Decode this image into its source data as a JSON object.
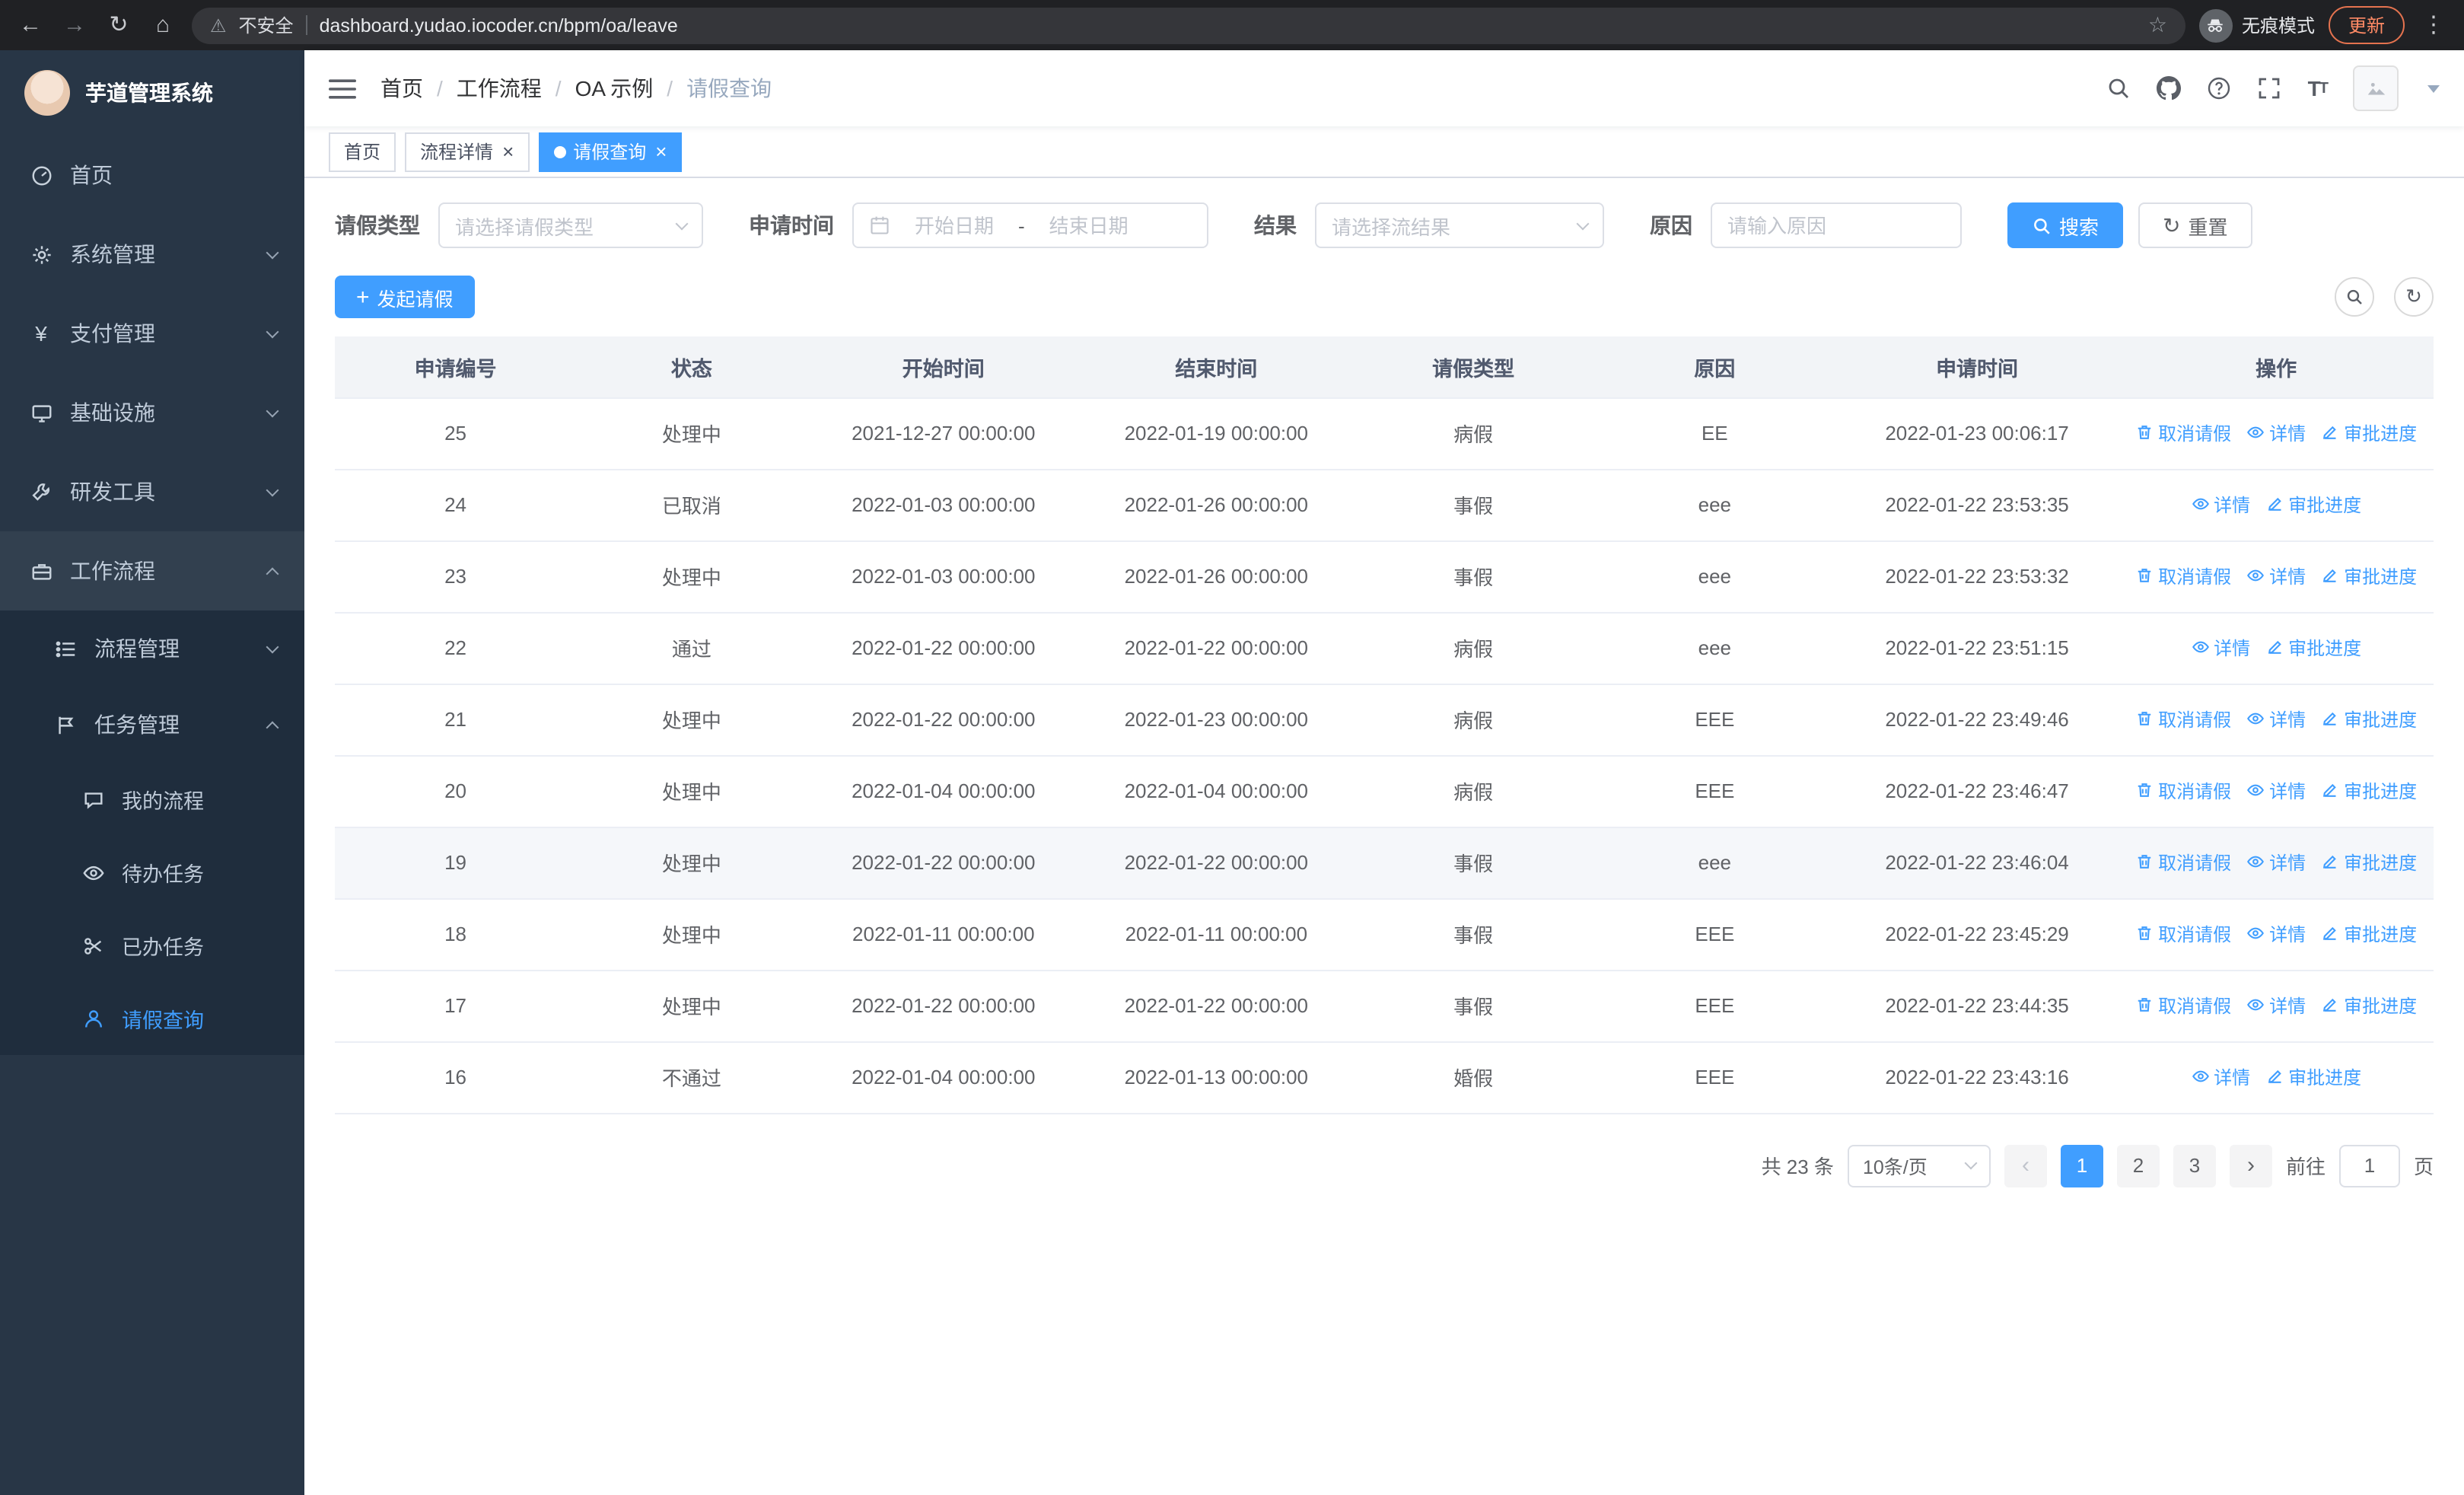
{
  "browser": {
    "security_warning": "不安全",
    "url": "dashboard.yudao.iocoder.cn/bpm/oa/leave",
    "incognito_label": "无痕模式",
    "update_label": "更新"
  },
  "sidebar": {
    "logo_title": "芋道管理系统",
    "menu": [
      {
        "label": "首页"
      },
      {
        "label": "系统管理"
      },
      {
        "label": "支付管理"
      },
      {
        "label": "基础设施"
      },
      {
        "label": "研发工具"
      },
      {
        "label": "工作流程"
      }
    ],
    "submenu": [
      {
        "label": "流程管理"
      },
      {
        "label": "任务管理"
      }
    ],
    "task_menu": [
      {
        "label": "我的流程"
      },
      {
        "label": "待办任务"
      },
      {
        "label": "已办任务"
      },
      {
        "label": "请假查询"
      }
    ]
  },
  "header": {
    "breadcrumb": [
      "首页",
      "工作流程",
      "OA 示例",
      "请假查询"
    ],
    "breadcrumb_separator": "/"
  },
  "tabs": [
    {
      "label": "首页",
      "closable": false,
      "active": false
    },
    {
      "label": "流程详情",
      "closable": true,
      "active": false
    },
    {
      "label": "请假查询",
      "closable": true,
      "active": true
    }
  ],
  "filters": {
    "leave_type_label": "请假类型",
    "leave_type_placeholder": "请选择请假类型",
    "apply_time_label": "申请时间",
    "start_date_placeholder": "开始日期",
    "range_separator": "-",
    "end_date_placeholder": "结束日期",
    "result_label": "结果",
    "result_placeholder": "请选择流结果",
    "reason_label": "原因",
    "reason_placeholder": "请输入原因",
    "search_label": "搜索",
    "reset_label": "重置"
  },
  "toolbar": {
    "create_label": "发起请假"
  },
  "table": {
    "columns": [
      "申请编号",
      "状态",
      "开始时间",
      "结束时间",
      "请假类型",
      "原因",
      "申请时间",
      "操作"
    ],
    "action_labels": {
      "cancel": "取消请假",
      "detail": "详情",
      "progress": "审批进度"
    },
    "rows": [
      {
        "id": "25",
        "status": "处理中",
        "start": "2021-12-27 00:00:00",
        "end": "2022-01-19 00:00:00",
        "type": "病假",
        "reason": "EE",
        "applied": "2022-01-23 00:06:17",
        "actions": [
          "cancel",
          "detail",
          "progress"
        ]
      },
      {
        "id": "24",
        "status": "已取消",
        "start": "2022-01-03 00:00:00",
        "end": "2022-01-26 00:00:00",
        "type": "事假",
        "reason": "eee",
        "applied": "2022-01-22 23:53:35",
        "actions": [
          "detail",
          "progress"
        ]
      },
      {
        "id": "23",
        "status": "处理中",
        "start": "2022-01-03 00:00:00",
        "end": "2022-01-26 00:00:00",
        "type": "事假",
        "reason": "eee",
        "applied": "2022-01-22 23:53:32",
        "actions": [
          "cancel",
          "detail",
          "progress"
        ]
      },
      {
        "id": "22",
        "status": "通过",
        "start": "2022-01-22 00:00:00",
        "end": "2022-01-22 00:00:00",
        "type": "病假",
        "reason": "eee",
        "applied": "2022-01-22 23:51:15",
        "actions": [
          "detail",
          "progress"
        ]
      },
      {
        "id": "21",
        "status": "处理中",
        "start": "2022-01-22 00:00:00",
        "end": "2022-01-23 00:00:00",
        "type": "病假",
        "reason": "EEE",
        "applied": "2022-01-22 23:49:46",
        "actions": [
          "cancel",
          "detail",
          "progress"
        ]
      },
      {
        "id": "20",
        "status": "处理中",
        "start": "2022-01-04 00:00:00",
        "end": "2022-01-04 00:00:00",
        "type": "病假",
        "reason": "EEE",
        "applied": "2022-01-22 23:46:47",
        "actions": [
          "cancel",
          "detail",
          "progress"
        ]
      },
      {
        "id": "19",
        "status": "处理中",
        "start": "2022-01-22 00:00:00",
        "end": "2022-01-22 00:00:00",
        "type": "事假",
        "reason": "eee",
        "applied": "2022-01-22 23:46:04",
        "actions": [
          "cancel",
          "detail",
          "progress"
        ],
        "hover": true
      },
      {
        "id": "18",
        "status": "处理中",
        "start": "2022-01-11 00:00:00",
        "end": "2022-01-11 00:00:00",
        "type": "事假",
        "reason": "EEE",
        "applied": "2022-01-22 23:45:29",
        "actions": [
          "cancel",
          "detail",
          "progress"
        ]
      },
      {
        "id": "17",
        "status": "处理中",
        "start": "2022-01-22 00:00:00",
        "end": "2022-01-22 00:00:00",
        "type": "事假",
        "reason": "EEE",
        "applied": "2022-01-22 23:44:35",
        "actions": [
          "cancel",
          "detail",
          "progress"
        ]
      },
      {
        "id": "16",
        "status": "不通过",
        "start": "2022-01-04 00:00:00",
        "end": "2022-01-13 00:00:00",
        "type": "婚假",
        "reason": "EEE",
        "applied": "2022-01-22 23:43:16",
        "actions": [
          "detail",
          "progress"
        ]
      }
    ]
  },
  "pagination": {
    "total_label": "共 23 条",
    "page_size": "10条/页",
    "pages": [
      "1",
      "2",
      "3"
    ],
    "active_page": "1",
    "goto_label": "前往",
    "goto_value": "1",
    "goto_suffix": "页"
  },
  "colors": {
    "primary": "#409eff",
    "sidebar_bg": "#283646",
    "submenu_bg": "#1f2d3d",
    "sidebar_text": "#bfcbd9",
    "table_header_bg": "#f2f4f7",
    "chrome_bg": "#202124",
    "update_accent": "#ff8a65"
  }
}
